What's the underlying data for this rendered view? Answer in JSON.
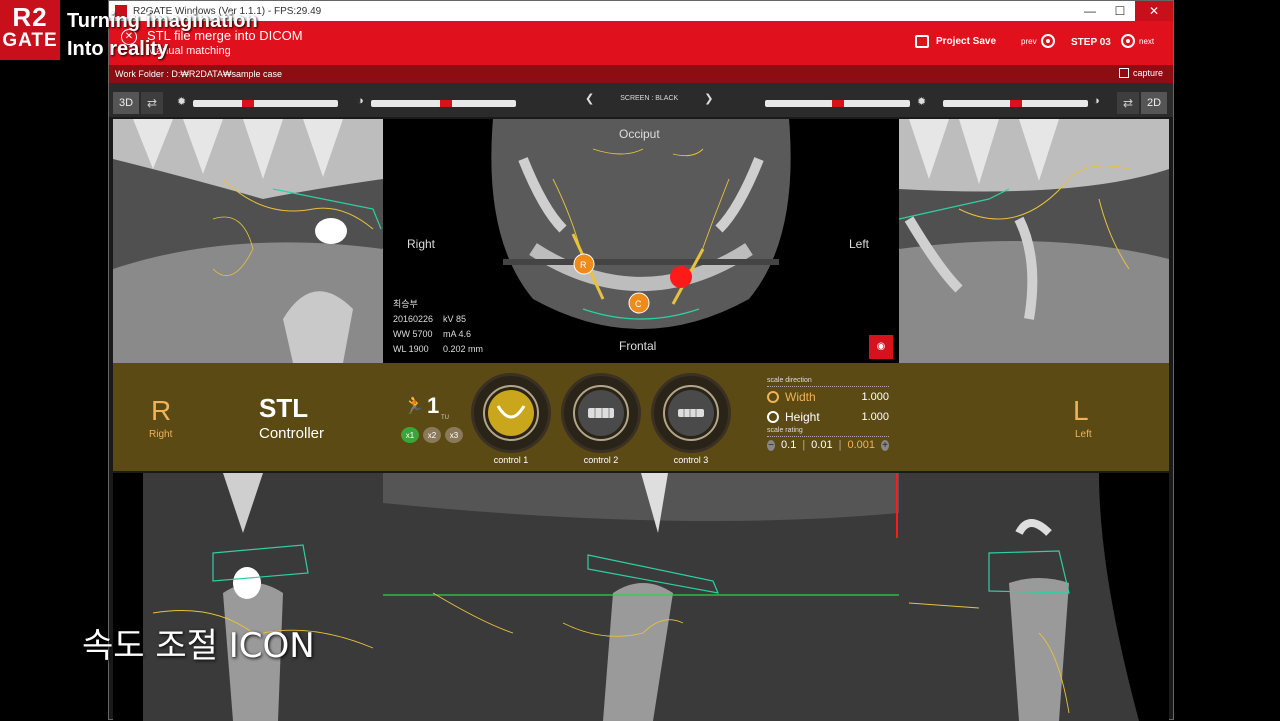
{
  "overlay": {
    "logo_line1": "R2",
    "logo_line2": "GATE",
    "line1": "Turning imagination",
    "line2": "Into reality",
    "caption": "속도 조절 ICON"
  },
  "window": {
    "title": "R2GATE Windows (Ver 1.1.1) - FPS:29.49",
    "minimize": "—",
    "maximize": "☐",
    "close": "✕"
  },
  "header": {
    "step_title": "STL file merge into DICOM",
    "step_sub": "Manual matching",
    "project_save": "Project Save",
    "prev": "prev",
    "step": "STEP 03",
    "next": "next"
  },
  "workbar": {
    "folder": "Work Folder : D:₩R2DATA₩sample case",
    "capture": "capture"
  },
  "toolbar": {
    "left_mode": "3D",
    "right_mode": "2D",
    "screen": "SCREEN : BLACK",
    "sliders": [
      0.38,
      0.52,
      0.5,
      0.5
    ]
  },
  "views": {
    "occiput": "Occiput",
    "right": "Right",
    "left": "Left",
    "frontal": "Frontal",
    "info": [
      [
        "최승부",
        ""
      ],
      [
        "20160226",
        "kV 85"
      ],
      [
        "WW 5700",
        "mA 4.6"
      ],
      [
        "WL 1900",
        "0.202 mm"
      ]
    ],
    "markers": [
      "R",
      "C"
    ]
  },
  "controller": {
    "right_letter": "R",
    "right_label": "Right",
    "left_letter": "L",
    "left_label": "Left",
    "title": "STL",
    "subtitle": "Controller",
    "speed_value": "1",
    "speed_unit": "TU",
    "speed_options": [
      "x1",
      "x2",
      "x3"
    ],
    "controls": [
      "control 1",
      "control 2",
      "control 3"
    ],
    "scale_direction": "scale direction",
    "width_label": "Width",
    "width_value": "1.000",
    "height_label": "Height",
    "height_value": "1.000",
    "scale_rating": "scale rating",
    "ratings": [
      "0.1",
      "0.01",
      "0.001"
    ]
  },
  "colors": {
    "accent_red": "#e0111c",
    "controller_bg": "#5c4a14",
    "highlight_orange": "#f0b25a"
  }
}
